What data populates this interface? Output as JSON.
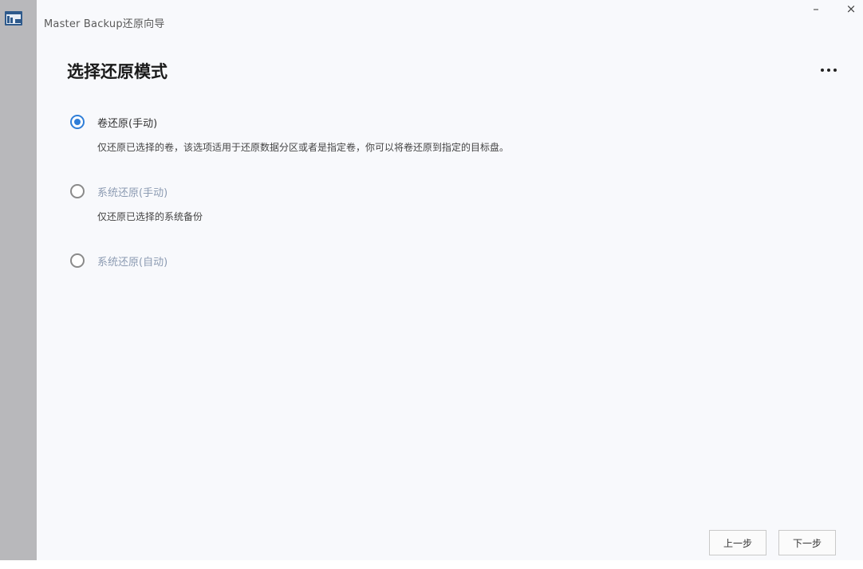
{
  "window": {
    "title": "Master Backup还原向导",
    "minimize_label": "–",
    "close_label": "×"
  },
  "page": {
    "heading": "选择还原模式",
    "more_icon": "more-horizontal-icon"
  },
  "options": [
    {
      "label": "卷还原(手动)",
      "description": "仅还原已选择的卷，该选项适用于还原数据分区或者是指定卷，你可以将卷还原到指定的目标盘。",
      "selected": true
    },
    {
      "label": "系统还原(手动)",
      "description": "仅还原已选择的系统备份",
      "selected": false
    },
    {
      "label": "系统还原(自动)",
      "description": "",
      "selected": false
    }
  ],
  "footer": {
    "prev_label": "上一步",
    "next_label": "下一步"
  },
  "colors": {
    "accent": "#2f7ed8",
    "rail": "#b8b8bb",
    "background": "#f8f9fc"
  }
}
